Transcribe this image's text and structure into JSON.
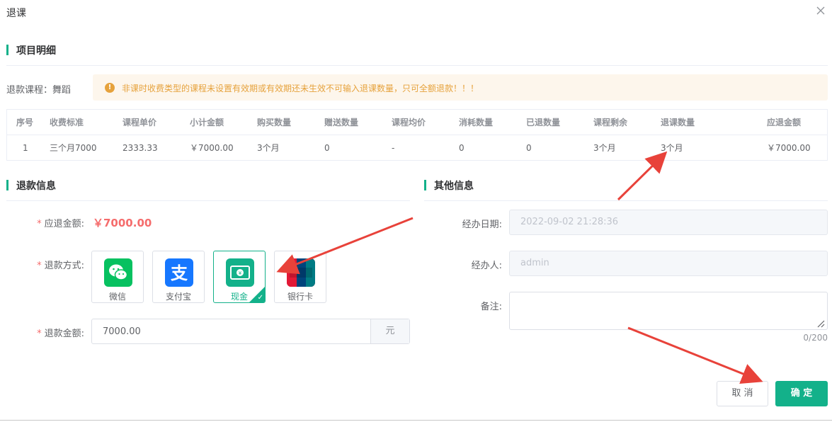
{
  "dialog": {
    "title": "退课"
  },
  "sections": {
    "details": "项目明细",
    "refund_info": "退款信息",
    "other_info": "其他信息"
  },
  "course": {
    "label": "退款课程：",
    "name": "舞蹈"
  },
  "alert": {
    "icon": "!",
    "text": "非课时收费类型的课程未设置有效期或有效期还未生效不可输入退课数量，只可全额退款！！！"
  },
  "table": {
    "headers": [
      "序号",
      "收费标准",
      "课程单价",
      "小计金额",
      "购买数量",
      "赠送数量",
      "课程均价",
      "消耗数量",
      "已退数量",
      "课程剩余",
      "退课数量",
      "应退金额"
    ],
    "rows": [
      [
        "1",
        "三个月7000",
        "2333.33",
        "￥7000.00",
        "3个月",
        "0",
        "-",
        "0",
        "0",
        "3个月",
        "3个月",
        "￥7000.00"
      ]
    ]
  },
  "refund": {
    "amount_label": "应退金额:",
    "amount_value": "￥7000.00",
    "method_label": "退款方式:",
    "methods": [
      {
        "label": "微信",
        "icon": "wechat-icon",
        "color": "#07c160",
        "selected": false
      },
      {
        "label": "支付宝",
        "icon": "alipay-icon",
        "color": "#1677ff",
        "selected": false
      },
      {
        "label": "现金",
        "icon": "cash-icon",
        "color": "#13b18a",
        "selected": true
      },
      {
        "label": "银行卡",
        "icon": "unionpay-icon",
        "color": "#e21836",
        "selected": false
      }
    ],
    "refund_amount_label": "退款金额:",
    "refund_amount_value": "7000.00",
    "unit": "元"
  },
  "other": {
    "date_label": "经办日期:",
    "date_value": "2022-09-02 21:28:36",
    "handler_label": "经办人:",
    "handler_value": "admin",
    "remark_label": "备注:",
    "remark_value": "",
    "counter": "0/200"
  },
  "buttons": {
    "cancel": "取 消",
    "confirm": "确 定"
  },
  "colors": {
    "accent": "#13b18a",
    "danger": "#f56c6c",
    "warning": "#e6a23c",
    "arrow": "#e8423a"
  }
}
